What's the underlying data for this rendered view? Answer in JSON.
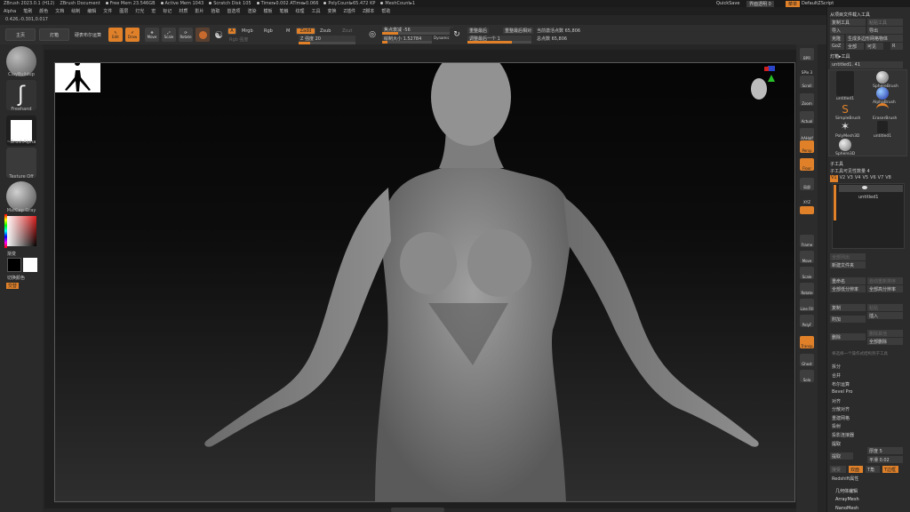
{
  "titlebar": {
    "app": "ZBrush 2023.0.1 (H12)",
    "doc": "ZBrush Document",
    "free_mem": "Free Mem 23.546GB",
    "active_mem": "Active Mem 1043",
    "scratch": "Scratch Disk 105",
    "timer": "Timer▸0.002 ATime▸0.066",
    "polycount": "PolyCount▸65.472 KP",
    "meshcount": "MeshCount▸1",
    "quicksave": "QuickSave",
    "transparency": "界面透明 0",
    "menus_btn": "菜单",
    "script": "DefaultZScript"
  },
  "menubar": [
    "Alpha",
    "笔刷",
    "颜色",
    "文档",
    "绘制",
    "编辑",
    "文件",
    "图层",
    "灯光",
    "宏",
    "标记",
    "材质",
    "影片",
    "拾取",
    "首选项",
    "渲染",
    "模板",
    "笔触",
    "纹理",
    "工具",
    "变换",
    "Z插件",
    "Z脚本",
    "帮助"
  ],
  "coords": "0.426,-0.301,0.017",
  "topbar": {
    "main": "主页",
    "lightbox": "灯箱",
    "liveboolean": "硬表布尔运算",
    "edit": "Edit",
    "draw": "Draw",
    "move": "Move",
    "scale": "Scale",
    "rotate": "Rotate",
    "a_btn": "A",
    "mrgb": "Mrgb",
    "rgb": "Rgb",
    "m": "M",
    "zadd": "Zadd",
    "zsub": "Zsub",
    "zcut": "Zcut",
    "rgb_intensity": "Rgb 强度",
    "z_intensity": "Z 强度 20",
    "focal_shift": "焦点衰减 -56",
    "draw_size": "绘制大小 1.52784",
    "dynamic": "Dynamic",
    "rearrange": "重整最后",
    "rearrange_relative": "重整最后相对",
    "adjust_last": "调整最后一个 1",
    "active_points": "当前激活点数 65,806",
    "total_points": "总点数 65,806"
  },
  "leftshelf": {
    "brush": "ClayBuildup",
    "stroke": "Freehand",
    "alpha": "~BrushAlpha",
    "texture": "Texture Off",
    "material": "MatCap Gray",
    "gradient": "渐变",
    "switch_color": "切换颜色",
    "alternate": "交替"
  },
  "rightshelf": [
    "透视",
    "地面",
    "局部",
    "XYZ",
    "Frame",
    "Move",
    "Scale",
    "Rotate",
    "Line Fill",
    "PolyF",
    "Transp",
    "Ghost",
    "Solo",
    "Xpose"
  ],
  "rightshelf_top": [
    "BPR",
    "SPix 3",
    "Scroll",
    "Zoom",
    "Actual",
    "AAHalf",
    "Dynamic",
    "Persp",
    "Floor"
  ],
  "palette": {
    "load_tool": "从项目文件载入工具",
    "copy_tool": "复制工具",
    "paste_tool": "粘贴工具",
    "import": "导入",
    "export": "导出",
    "clone": "克隆",
    "make_polymesh": "生成多边形网格物体",
    "goz": "GoZ",
    "all": "全部",
    "visible": "可见",
    "r": "R",
    "lightbox_tools": "灯箱▸工具",
    "current_tool": "untitled1. 41",
    "tools": [
      "untitled1",
      "SphereBrush",
      "AlphaBrush",
      "SimpleBrush",
      "EraserBrush",
      "PolyMesh3D",
      "untitled1",
      "Sphere3D"
    ],
    "subtool_header": "子工具",
    "subtool_count": "子工具可见性数量 4",
    "visibility_tabs": [
      "V1",
      "V2",
      "V3",
      "V4",
      "V5",
      "V6",
      "V7",
      "V8"
    ],
    "subtool_name": "untitled1",
    "list_all": "全部列出",
    "new_folder": "新建文件夹",
    "rename": "重命名",
    "auto_reorder": "自动重新排序",
    "all_low": "全部低分辨率",
    "all_high": "全部高分辨率",
    "copy": "复制",
    "paste": "粘贴",
    "append": "附加",
    "insert": "插入",
    "delete": "删除",
    "delete_other": "删除其他",
    "delete_all": "全部删除",
    "merge_msg": "将选择一个操作式结构到子工具",
    "split": "拆分",
    "merge": "合并",
    "boolean": "布尔运算",
    "bevel_pro": "Bevel Pro",
    "align": "对齐",
    "distribute": "分散对齐",
    "remesh": "重建网格",
    "project": "投射",
    "extract_shell": "投影连接器",
    "extract": "提取",
    "thickness": "厚度 5",
    "smooth": "平滑 0.02",
    "accept": "接受",
    "double": "双面",
    "tcorner": "T角",
    "tborder": "T边框",
    "redshift": "Redshift属性",
    "geometry_edit": "几何体编辑",
    "arraymesh": "ArrayMesh",
    "nanomesh": "NanoMesh"
  },
  "colors": {
    "accent": "#e0812a",
    "bg": "#262626",
    "panel": "#2b2b2b",
    "skin": "#8c8c8c"
  }
}
